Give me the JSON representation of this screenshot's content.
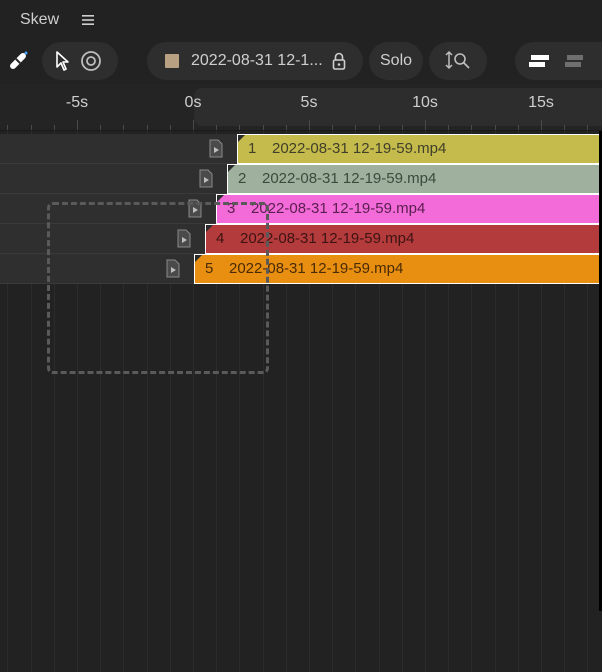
{
  "panel": {
    "title": "Skew"
  },
  "toolbar": {
    "clip_name": "2022-08-31 12-1...",
    "solo_label": "Solo",
    "swatch_color": "#b7a182"
  },
  "ruler": {
    "labels": [
      "-5s",
      "0s",
      "5s",
      "10s",
      "15s"
    ]
  },
  "clips": [
    {
      "index": "1",
      "name": "2022-08-31 12-19-59.mp4",
      "color": "#c5bb4c",
      "text_color": "#3f3f2a"
    },
    {
      "index": "2",
      "name": "2022-08-31 12-19-59.mp4",
      "color": "#9fb09f",
      "text_color": "#3c4a3c"
    },
    {
      "index": "3",
      "name": "2022-08-31 12-19-59.mp4",
      "color": "#f26bd8",
      "text_color": "#5a1e4f"
    },
    {
      "index": "4",
      "name": "2022-08-31 12-19-59.mp4",
      "color": "#b33b3b",
      "text_color": "#3e1313"
    },
    {
      "index": "5",
      "name": "2022-08-31 12-19-59.mp4",
      "color": "#e88f12",
      "text_color": "#4a2b05"
    }
  ],
  "icons": {
    "tool": "magic-wand-icon",
    "select": "cursor-arrow-icon",
    "target": "target-icon",
    "lock": "lock-icon",
    "swap": "vertical-arrows-search-icon",
    "align_left": "align-left-icon",
    "distribute": "distribute-icon"
  }
}
